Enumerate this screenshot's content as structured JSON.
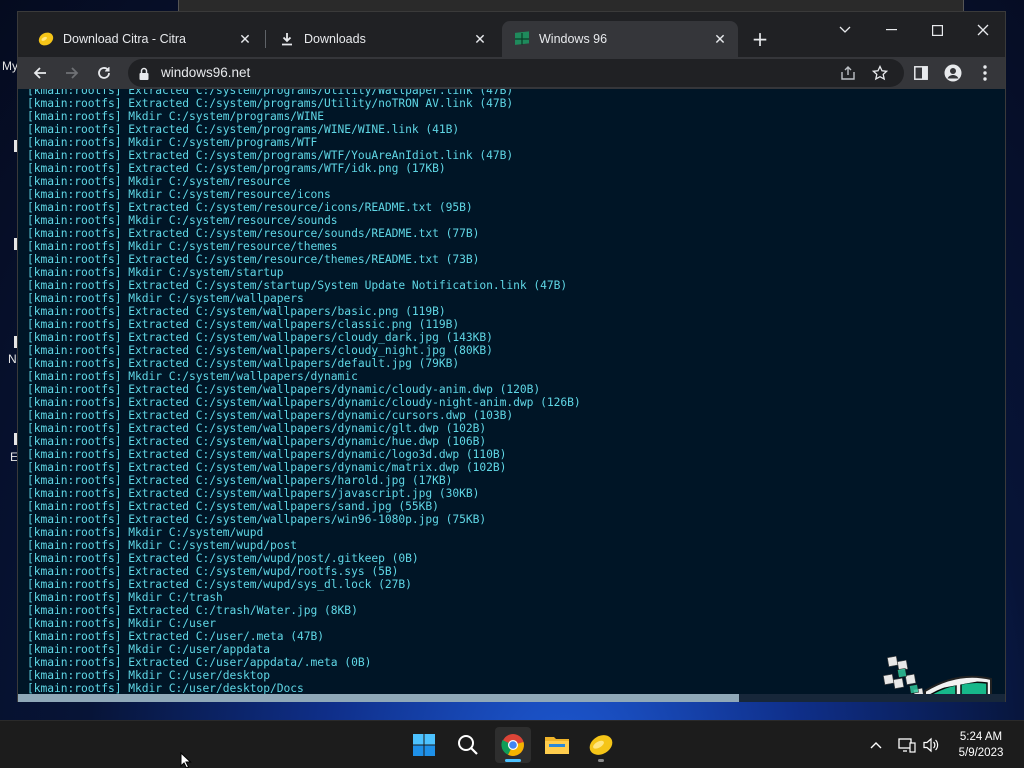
{
  "desktop": {
    "icon_letters": [
      "My",
      "N",
      "E"
    ]
  },
  "browser": {
    "tabs": [
      {
        "title": "Download Citra - Citra",
        "icon": "citra-icon",
        "active": false
      },
      {
        "title": "Downloads",
        "icon": "download-icon",
        "active": false
      },
      {
        "title": "Windows 96",
        "icon": "windows96-icon",
        "active": true
      }
    ],
    "address": "windows96.net"
  },
  "terminal": {
    "lines": [
      "[kmain:rootfs] Extracted C:/system/programs/Utility/Wallpaper.link (47B)",
      "[kmain:rootfs] Extracted C:/system/programs/Utility/noTRON AV.link (47B)",
      "[kmain:rootfs] Mkdir C:/system/programs/WINE",
      "[kmain:rootfs] Extracted C:/system/programs/WINE/WINE.link (41B)",
      "[kmain:rootfs] Mkdir C:/system/programs/WTF",
      "[kmain:rootfs] Extracted C:/system/programs/WTF/YouAreAnIdiot.link (47B)",
      "[kmain:rootfs] Extracted C:/system/programs/WTF/idk.png (17KB)",
      "[kmain:rootfs] Mkdir C:/system/resource",
      "[kmain:rootfs] Mkdir C:/system/resource/icons",
      "[kmain:rootfs] Extracted C:/system/resource/icons/README.txt (95B)",
      "[kmain:rootfs] Mkdir C:/system/resource/sounds",
      "[kmain:rootfs] Extracted C:/system/resource/sounds/README.txt (77B)",
      "[kmain:rootfs] Mkdir C:/system/resource/themes",
      "[kmain:rootfs] Extracted C:/system/resource/themes/README.txt (73B)",
      "[kmain:rootfs] Mkdir C:/system/startup",
      "[kmain:rootfs] Extracted C:/system/startup/System Update Notification.link (47B)",
      "[kmain:rootfs] Mkdir C:/system/wallpapers",
      "[kmain:rootfs] Extracted C:/system/wallpapers/basic.png (119B)",
      "[kmain:rootfs] Extracted C:/system/wallpapers/classic.png (119B)",
      "[kmain:rootfs] Extracted C:/system/wallpapers/cloudy_dark.jpg (143KB)",
      "[kmain:rootfs] Extracted C:/system/wallpapers/cloudy_night.jpg (80KB)",
      "[kmain:rootfs] Extracted C:/system/wallpapers/default.jpg (79KB)",
      "[kmain:rootfs] Mkdir C:/system/wallpapers/dynamic",
      "[kmain:rootfs] Extracted C:/system/wallpapers/dynamic/cloudy-anim.dwp (120B)",
      "[kmain:rootfs] Extracted C:/system/wallpapers/dynamic/cloudy-night-anim.dwp (126B)",
      "[kmain:rootfs] Extracted C:/system/wallpapers/dynamic/cursors.dwp (103B)",
      "[kmain:rootfs] Extracted C:/system/wallpapers/dynamic/glt.dwp (102B)",
      "[kmain:rootfs] Extracted C:/system/wallpapers/dynamic/hue.dwp (106B)",
      "[kmain:rootfs] Extracted C:/system/wallpapers/dynamic/logo3d.dwp (110B)",
      "[kmain:rootfs] Extracted C:/system/wallpapers/dynamic/matrix.dwp (102B)",
      "[kmain:rootfs] Extracted C:/system/wallpapers/harold.jpg (17KB)",
      "[kmain:rootfs] Extracted C:/system/wallpapers/javascript.jpg (30KB)",
      "[kmain:rootfs] Extracted C:/system/wallpapers/sand.jpg (55KB)",
      "[kmain:rootfs] Extracted C:/system/wallpapers/win96-1080p.jpg (75KB)",
      "[kmain:rootfs] Mkdir C:/system/wupd",
      "[kmain:rootfs] Mkdir C:/system/wupd/post",
      "[kmain:rootfs] Extracted C:/system/wupd/post/.gitkeep (0B)",
      "[kmain:rootfs] Extracted C:/system/wupd/rootfs.sys (5B)",
      "[kmain:rootfs] Extracted C:/system/wupd/sys_dl.lock (27B)",
      "[kmain:rootfs] Mkdir C:/trash",
      "[kmain:rootfs] Extracted C:/trash/Water.jpg (8KB)",
      "[kmain:rootfs] Mkdir C:/user",
      "[kmain:rootfs] Extracted C:/user/.meta (47B)",
      "[kmain:rootfs] Mkdir C:/user/appdata",
      "[kmain:rootfs] Extracted C:/user/appdata/.meta (0B)",
      "[kmain:rootfs] Mkdir C:/user/desktop",
      "[kmain:rootfs] Mkdir C:/user/desktop/Docs"
    ],
    "text_color": "#5fd7e6",
    "background": "#001526",
    "scroll_position_fraction": 0.73
  },
  "taskbar": {
    "apps": [
      {
        "name": "start",
        "icon": "windows-start-icon"
      },
      {
        "name": "search",
        "icon": "search-icon"
      },
      {
        "name": "chrome",
        "icon": "chrome-icon"
      },
      {
        "name": "file-explorer",
        "icon": "folder-icon"
      },
      {
        "name": "citra",
        "icon": "citra-icon"
      }
    ],
    "time": "5:24 AM",
    "date": "5/9/2023"
  }
}
